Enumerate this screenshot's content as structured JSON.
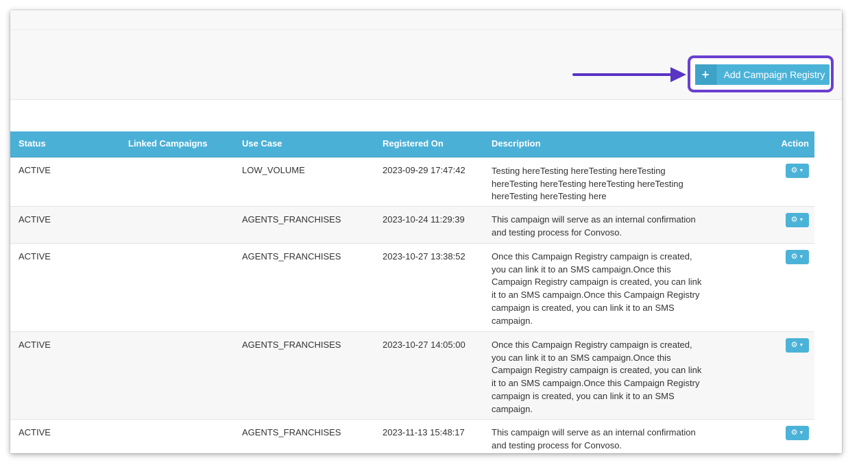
{
  "toolbar": {
    "add_button_label": "Add Campaign Registry",
    "add_icon": "+"
  },
  "table": {
    "columns": {
      "status": "Status",
      "linked": "Linked Campaigns",
      "use_case": "Use Case",
      "registered": "Registered On",
      "description": "Description",
      "action": "Action"
    },
    "rows": [
      {
        "status": "ACTIVE",
        "linked": "",
        "use_case": "LOW_VOLUME",
        "registered": "2023-09-29 17:47:42",
        "description": "Testing hereTesting hereTesting hereTesting hereTesting hereTesting hereTesting hereTesting hereTesting hereTesting here"
      },
      {
        "status": "ACTIVE",
        "linked": "",
        "use_case": "AGENTS_FRANCHISES",
        "registered": "2023-10-24 11:29:39",
        "description": "This campaign will serve as an internal confirmation and testing process for Convoso."
      },
      {
        "status": "ACTIVE",
        "linked": "",
        "use_case": "AGENTS_FRANCHISES",
        "registered": "2023-10-27 13:38:52",
        "description": "Once this Campaign Registry campaign is created, you can link it to an SMS campaign.Once this Campaign Registry campaign is created, you can link it to an SMS campaign.Once this Campaign Registry campaign is created, you can link it to an SMS campaign."
      },
      {
        "status": "ACTIVE",
        "linked": "",
        "use_case": "AGENTS_FRANCHISES",
        "registered": "2023-10-27 14:05:00",
        "description": "Once this Campaign Registry campaign is created, you can link it to an SMS campaign.Once this Campaign Registry campaign is created, you can link it to an SMS campaign.Once this Campaign Registry campaign is created, you can link it to an SMS campaign."
      },
      {
        "status": "ACTIVE",
        "linked": "",
        "use_case": "AGENTS_FRANCHISES",
        "registered": "2023-11-13 15:48:17",
        "description": "This campaign will serve as an internal confirmation and testing process for Convoso."
      }
    ]
  },
  "icons": {
    "add": "plus-icon",
    "action": "gear-icon",
    "caret": "caret-down-icon",
    "annotation": "arrow-right-icon"
  },
  "colors": {
    "accent": "#4bb3d8",
    "header": "#4bb0d6",
    "highlight": "#6a3fd0"
  }
}
